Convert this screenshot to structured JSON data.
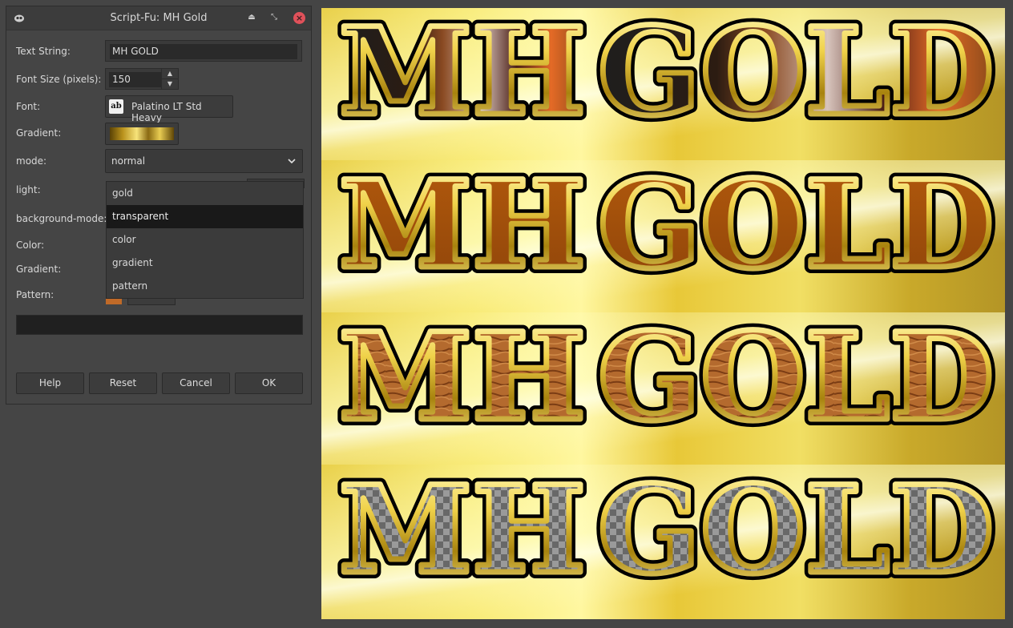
{
  "dialog": {
    "title": "Script-Fu: MH Gold",
    "labels": {
      "text_string": "Text String:",
      "font_size": "Font Size (pixels):",
      "font": "Font:",
      "gradient": "Gradient:",
      "mode": "mode:",
      "light": "light:",
      "background_mode": "background-mode:",
      "color": "Color:",
      "gradient2": "Gradient:",
      "pattern": "Pattern:"
    },
    "text_string_value": "MH GOLD",
    "font_size_value": "150",
    "font_value": "Palatino LT Std Heavy",
    "font_icon": "Ꞵ",
    "mode_value": "normal",
    "dropdown_options": [
      "gold",
      "transparent",
      "color",
      "gradient",
      "pattern"
    ],
    "dropdown_selected_index": 1,
    "buttons": {
      "help": "Help",
      "reset": "Reset",
      "cancel": "Cancel",
      "ok": "OK"
    },
    "icons": [
      "app-icon",
      "shade-icon",
      "restore-icon",
      "close-icon",
      "chevron-down-icon",
      "spin-up-icon",
      "spin-down-icon"
    ]
  },
  "canvas": {
    "text": [
      "MH",
      "GOLD"
    ],
    "fill_styles": [
      "multicolor",
      "orange",
      "wood",
      "transparent"
    ],
    "colors": {
      "gold_light": "#fff6a0",
      "gold_dark": "#6e5206",
      "outline": "#000000",
      "orange": "#a8520c",
      "wood": "#b06a2c"
    }
  }
}
